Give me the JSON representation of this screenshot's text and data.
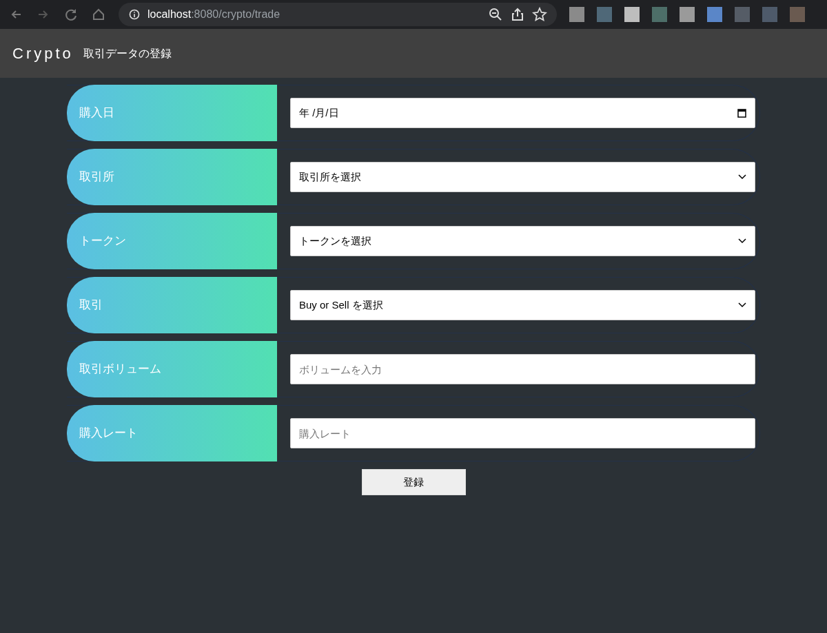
{
  "browser": {
    "url_host": "localhost",
    "url_rest": ":8080/crypto/trade"
  },
  "header": {
    "brand": "Crypto",
    "title": "取引データの登録"
  },
  "fields": [
    {
      "kind": "date",
      "label": "購入日",
      "value": "年 /月/日"
    },
    {
      "kind": "select",
      "label": "取引所",
      "value": "取引所を選択"
    },
    {
      "kind": "select",
      "label": "トークン",
      "value": "トークンを選択"
    },
    {
      "kind": "select",
      "label": "取引",
      "value": "Buy or Sell を選択"
    },
    {
      "kind": "text",
      "label": "取引ボリューム",
      "placeholder": "ボリュームを入力"
    },
    {
      "kind": "text",
      "label": "購入レート",
      "placeholder": "購入レート"
    }
  ],
  "submit": "登録"
}
